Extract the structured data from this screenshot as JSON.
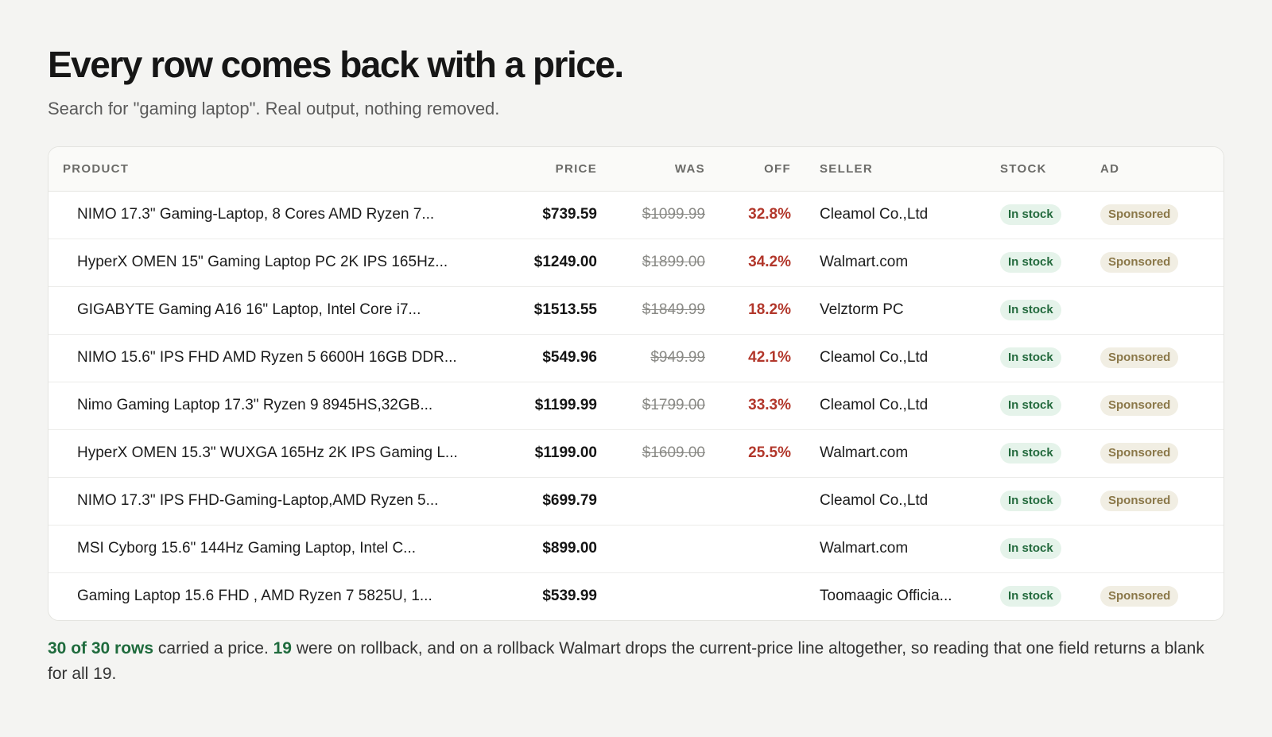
{
  "header": {
    "title": "Every row comes back with a price.",
    "subtitle": "Search for \"gaming laptop\". Real output, nothing removed."
  },
  "table": {
    "columns": {
      "product": "PRODUCT",
      "price": "PRICE",
      "was": "WAS",
      "off": "OFF",
      "seller": "SELLER",
      "stock": "STOCK",
      "ad": "AD"
    },
    "rows": [
      {
        "product": "NIMO 17.3\" Gaming-Laptop, 8 Cores AMD Ryzen 7...",
        "price": "$739.59",
        "was": "$1099.99",
        "off": "32.8%",
        "seller": "Cleamol Co.,Ltd",
        "stock": "In stock",
        "ad": "Sponsored"
      },
      {
        "product": "HyperX OMEN 15\" Gaming Laptop PC 2K IPS 165Hz...",
        "price": "$1249.00",
        "was": "$1899.00",
        "off": "34.2%",
        "seller": "Walmart.com",
        "stock": "In stock",
        "ad": "Sponsored"
      },
      {
        "product": "GIGABYTE Gaming A16 16\" Laptop, Intel Core i7...",
        "price": "$1513.55",
        "was": "$1849.99",
        "off": "18.2%",
        "seller": "Velztorm PC",
        "stock": "In stock",
        "ad": ""
      },
      {
        "product": "NIMO 15.6\" IPS FHD AMD Ryzen 5 6600H 16GB DDR...",
        "price": "$549.96",
        "was": "$949.99",
        "off": "42.1%",
        "seller": "Cleamol Co.,Ltd",
        "stock": "In stock",
        "ad": "Sponsored"
      },
      {
        "product": "Nimo Gaming Laptop 17.3\" Ryzen 9 8945HS,32GB...",
        "price": "$1199.99",
        "was": "$1799.00",
        "off": "33.3%",
        "seller": "Cleamol Co.,Ltd",
        "stock": "In stock",
        "ad": "Sponsored"
      },
      {
        "product": "HyperX OMEN 15.3\" WUXGA 165Hz 2K IPS Gaming L...",
        "price": "$1199.00",
        "was": "$1609.00",
        "off": "25.5%",
        "seller": "Walmart.com",
        "stock": "In stock",
        "ad": "Sponsored"
      },
      {
        "product": "NIMO 17.3\" IPS FHD-Gaming-Laptop,AMD Ryzen 5...",
        "price": "$699.79",
        "was": "",
        "off": "",
        "seller": "Cleamol Co.,Ltd",
        "stock": "In stock",
        "ad": "Sponsored"
      },
      {
        "product": "MSI Cyborg 15.6\" 144Hz Gaming Laptop, Intel C...",
        "price": "$899.00",
        "was": "",
        "off": "",
        "seller": "Walmart.com",
        "stock": "In stock",
        "ad": ""
      },
      {
        "product": "Gaming Laptop 15.6 FHD , AMD Ryzen 7 5825U, 1...",
        "price": "$539.99",
        "was": "",
        "off": "",
        "seller": "Toomaagic Officia...",
        "stock": "In stock",
        "ad": "Sponsored"
      }
    ]
  },
  "footer": {
    "highlight_rows": "30 of 30 rows",
    "text_1": " carried a price. ",
    "highlight_rollback": "19",
    "text_2": " were on rollback, and on a rollback Walmart drops the current-price line altogether, so reading that one field returns a blank for all 19."
  },
  "colors": {
    "accent_green": "#1f6b3d",
    "discount_red": "#b2372b",
    "stock_badge_bg": "#e5f3ea",
    "sponsored_badge_bg": "#f1eee3"
  }
}
